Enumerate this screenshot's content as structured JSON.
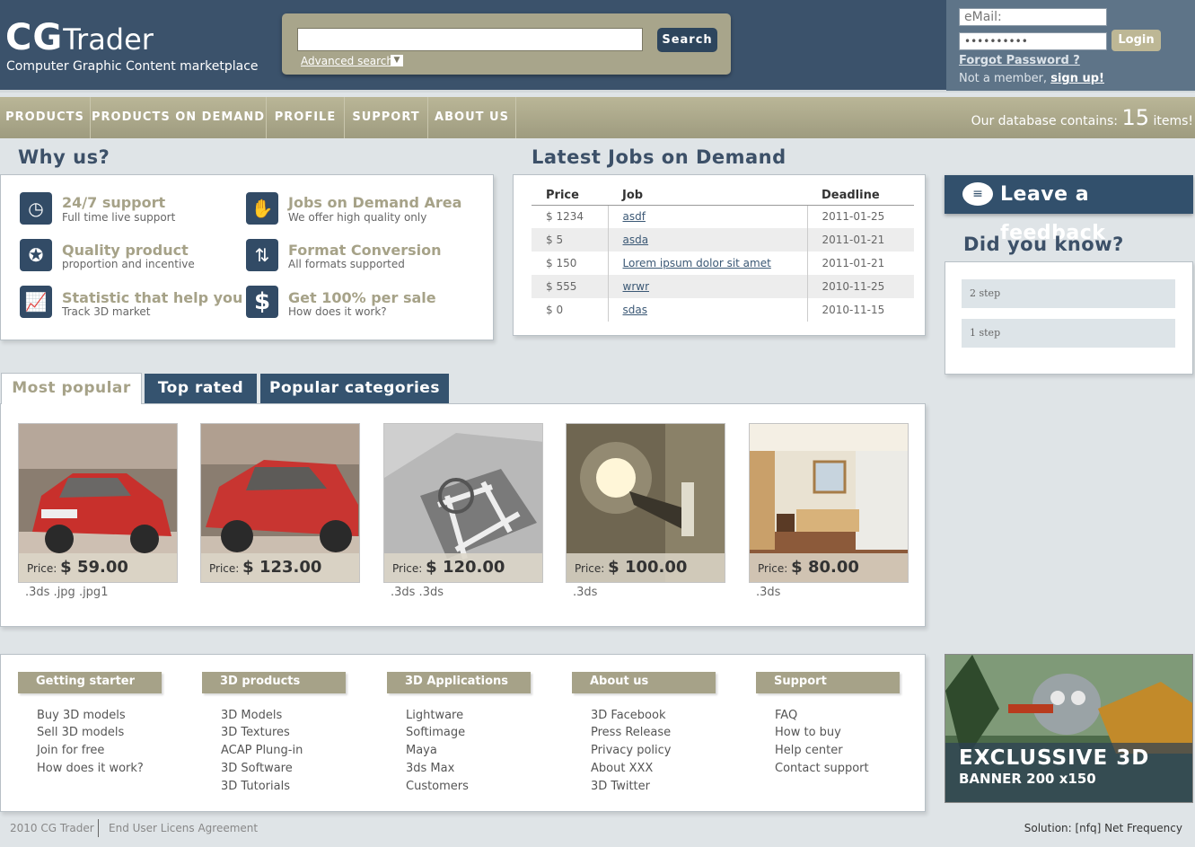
{
  "header": {
    "logo_cg": "CG",
    "logo_trader": "Trader",
    "tagline": "Computer Graphic Content marketplace",
    "search_button": "Search",
    "advanced_search": "Advanced search",
    "email_placeholder": "eMail:",
    "password_mask": "••••••••••",
    "login_button": "Login",
    "forgot_password": "Forgot Password ?",
    "not_member": "Not a member, ",
    "sign_up": "sign up!"
  },
  "nav": {
    "items": [
      "PRODUCTS",
      "PRODUCTS ON DEMAND",
      "PROFILE",
      "SUPPORT",
      "ABOUT US"
    ],
    "db_prefix": "Our database contains:",
    "db_count": "15",
    "db_suffix": "items!"
  },
  "why_us": {
    "title": "Why us?",
    "items": [
      {
        "title": "24/7 support",
        "sub": "Full time live support",
        "icon": "clock-icon"
      },
      {
        "title": "Jobs on Demand Area",
        "sub": "We offer high quality only",
        "icon": "handshake-icon"
      },
      {
        "title": "Quality product",
        "sub": "proportion and incentive",
        "icon": "quality-seal-icon"
      },
      {
        "title": "Format Conversion",
        "sub": "All formats supported",
        "icon": "convert-arrows-icon"
      },
      {
        "title": "Statistic that help you",
        "sub": "Track 3D market",
        "icon": "chart-icon"
      },
      {
        "title": "Get 100% per sale",
        "sub": "How does it work?",
        "icon": "dollar-icon"
      }
    ]
  },
  "jobs": {
    "title": "Latest Jobs on Demand",
    "headers": [
      "Price",
      "Job",
      "Deadline"
    ],
    "rows": [
      {
        "price": "$ 1234",
        "job": "asdf",
        "deadline": "2011-01-25"
      },
      {
        "price": "$ 5",
        "job": "asda",
        "deadline": "2011-01-21"
      },
      {
        "price": "$ 150",
        "job": "Lorem ipsum dolor sit amet",
        "deadline": "2011-01-21"
      },
      {
        "price": "$ 555",
        "job": "wrwr",
        "deadline": "2010-11-25"
      },
      {
        "price": "$ 0",
        "job": "sdas",
        "deadline": "2010-11-15"
      }
    ]
  },
  "sidebar": {
    "feedback": "Leave a feedback",
    "did_you_know": "Did you know?",
    "steps": [
      "2 step",
      "1 step"
    ]
  },
  "tabs": [
    "Most popular",
    "Top rated",
    "Popular categories"
  ],
  "products": [
    {
      "price_label": "Price:",
      "price": "$ 59.00",
      "formats": ".3ds .jpg .jpg1"
    },
    {
      "price_label": "Price:",
      "price": "$ 123.00",
      "formats": ""
    },
    {
      "price_label": "Price:",
      "price": "$ 120.00",
      "formats": ".3ds .3ds"
    },
    {
      "price_label": "Price:",
      "price": "$ 100.00",
      "formats": ".3ds"
    },
    {
      "price_label": "Price:",
      "price": "$ 80.00",
      "formats": ".3ds"
    }
  ],
  "footer_columns": [
    {
      "title": "Getting starter",
      "links": [
        "Buy 3D models",
        "Sell 3D models",
        "Join for free",
        "How does it work?"
      ]
    },
    {
      "title": "3D products",
      "links": [
        "3D Models",
        "3D Textures",
        "ACAP Plung-in",
        "3D Software",
        "3D Tutorials"
      ]
    },
    {
      "title": "3D Applications",
      "links": [
        "Lightware",
        "Softimage",
        "Maya",
        "3ds Max",
        "Customers"
      ]
    },
    {
      "title": "About us",
      "links": [
        "3D Facebook",
        "Press Release",
        "Privacy policy",
        "About XXX",
        "3D Twitter"
      ]
    },
    {
      "title": "Support",
      "links": [
        "FAQ",
        "How to buy",
        "Help center",
        "Contact support"
      ]
    }
  ],
  "banner": {
    "line1": "EXCLUSSIVE 3D",
    "line2": "BANNER 200 x150"
  },
  "footer": {
    "copyright": "2010 CG Trader",
    "eula": "End User Licens Agreement",
    "solution": "Solution: [nfq] Net Frequency"
  },
  "colors": {
    "header": "#3b526b",
    "nav": "#a6a288",
    "accent_blue": "#35536f",
    "page_bg": "#dfe4e7"
  }
}
